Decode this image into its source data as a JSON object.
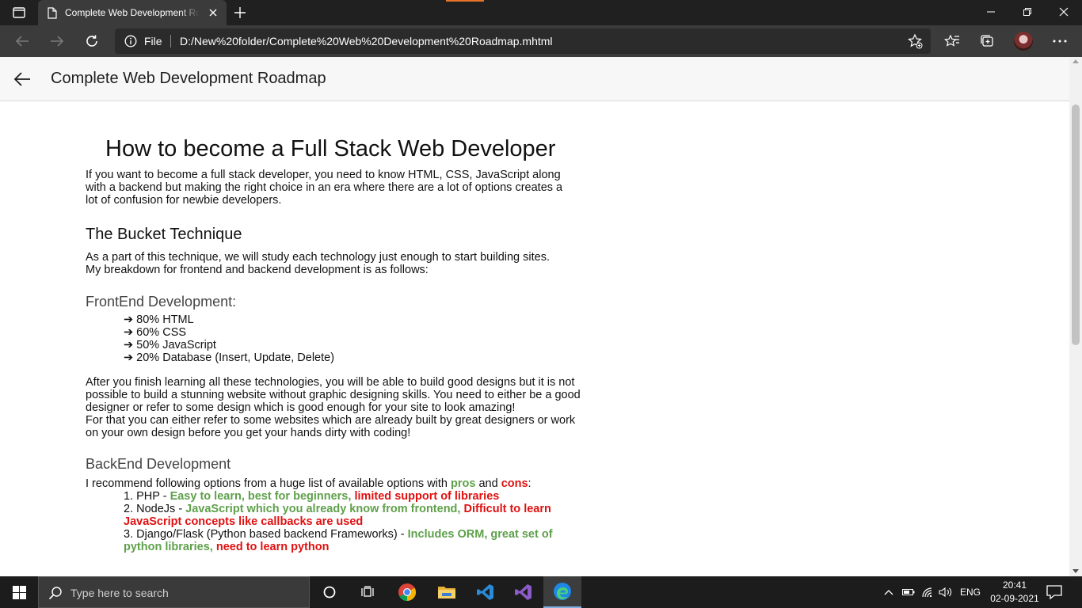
{
  "browser": {
    "tab": {
      "title": "Complete Web Development Roadmap"
    },
    "address": {
      "scheme_label": "File",
      "url": "D:/New%20folder/Complete%20Web%20Development%20Roadmap.mhtml"
    }
  },
  "reader": {
    "title": "Complete Web Development Roadmap"
  },
  "article": {
    "heading": "How to become a Full Stack Web Developer",
    "intro": "If you want to become a full stack developer, you need to know HTML, CSS, JavaScript along with a backend but making the right choice in an era where there are a lot of options creates a lot of confusion for newbie developers.",
    "bucket_heading": "The Bucket Technique",
    "bucket_line1": "As a part of this technique, we will study each technology just enough to start building sites.",
    "bucket_line2": "My breakdown for frontend and backend development is as follows:",
    "frontend_heading": "FrontEnd Development:",
    "frontend_items": [
      "➔ 80% HTML",
      "➔ 60% CSS",
      "➔ 50% JavaScript",
      "➔ 20% Database (Insert, Update, Delete)"
    ],
    "after_p1": "After you finish learning all these technologies, you will be able to build good designs but it is not possible to build a stunning website without graphic designing skills. You need to either be a good designer or refer to some design which is good enough for your site to look amazing!",
    "after_p2": "For that you can either refer to some websites which are already built by great designers or work on your own design before you get your hands dirty with coding!",
    "backend_heading": "BackEnd Development",
    "recommend_prefix": "I recommend following options from a huge list of available options with ",
    "recommend_pros": "pros",
    "recommend_and": " and ",
    "recommend_cons": "cons",
    "recommend_suffix": ":",
    "backend_items": [
      {
        "label": "1. PHP - ",
        "pro": "Easy to learn, best for beginners, ",
        "con": "limited support of libraries"
      },
      {
        "label": "2. NodeJs - ",
        "pro": "JavaScript which you already know from frontend, ",
        "con": "Difficult to learn JavaScript concepts like callbacks are used"
      },
      {
        "label": "3. Django/Flask (Python based backend Frameworks) - ",
        "pro": "Includes ORM, great set of python libraries, ",
        "con": "need to learn python"
      }
    ]
  },
  "taskbar": {
    "search_placeholder": "Type here to search",
    "language": "ENG",
    "time": "20:41",
    "date": "02-09-2021"
  },
  "colors": {
    "pro": "#5ea04a",
    "con": "#e01010",
    "browser_frame": "#202020",
    "toolbar": "#3b3b3b"
  }
}
